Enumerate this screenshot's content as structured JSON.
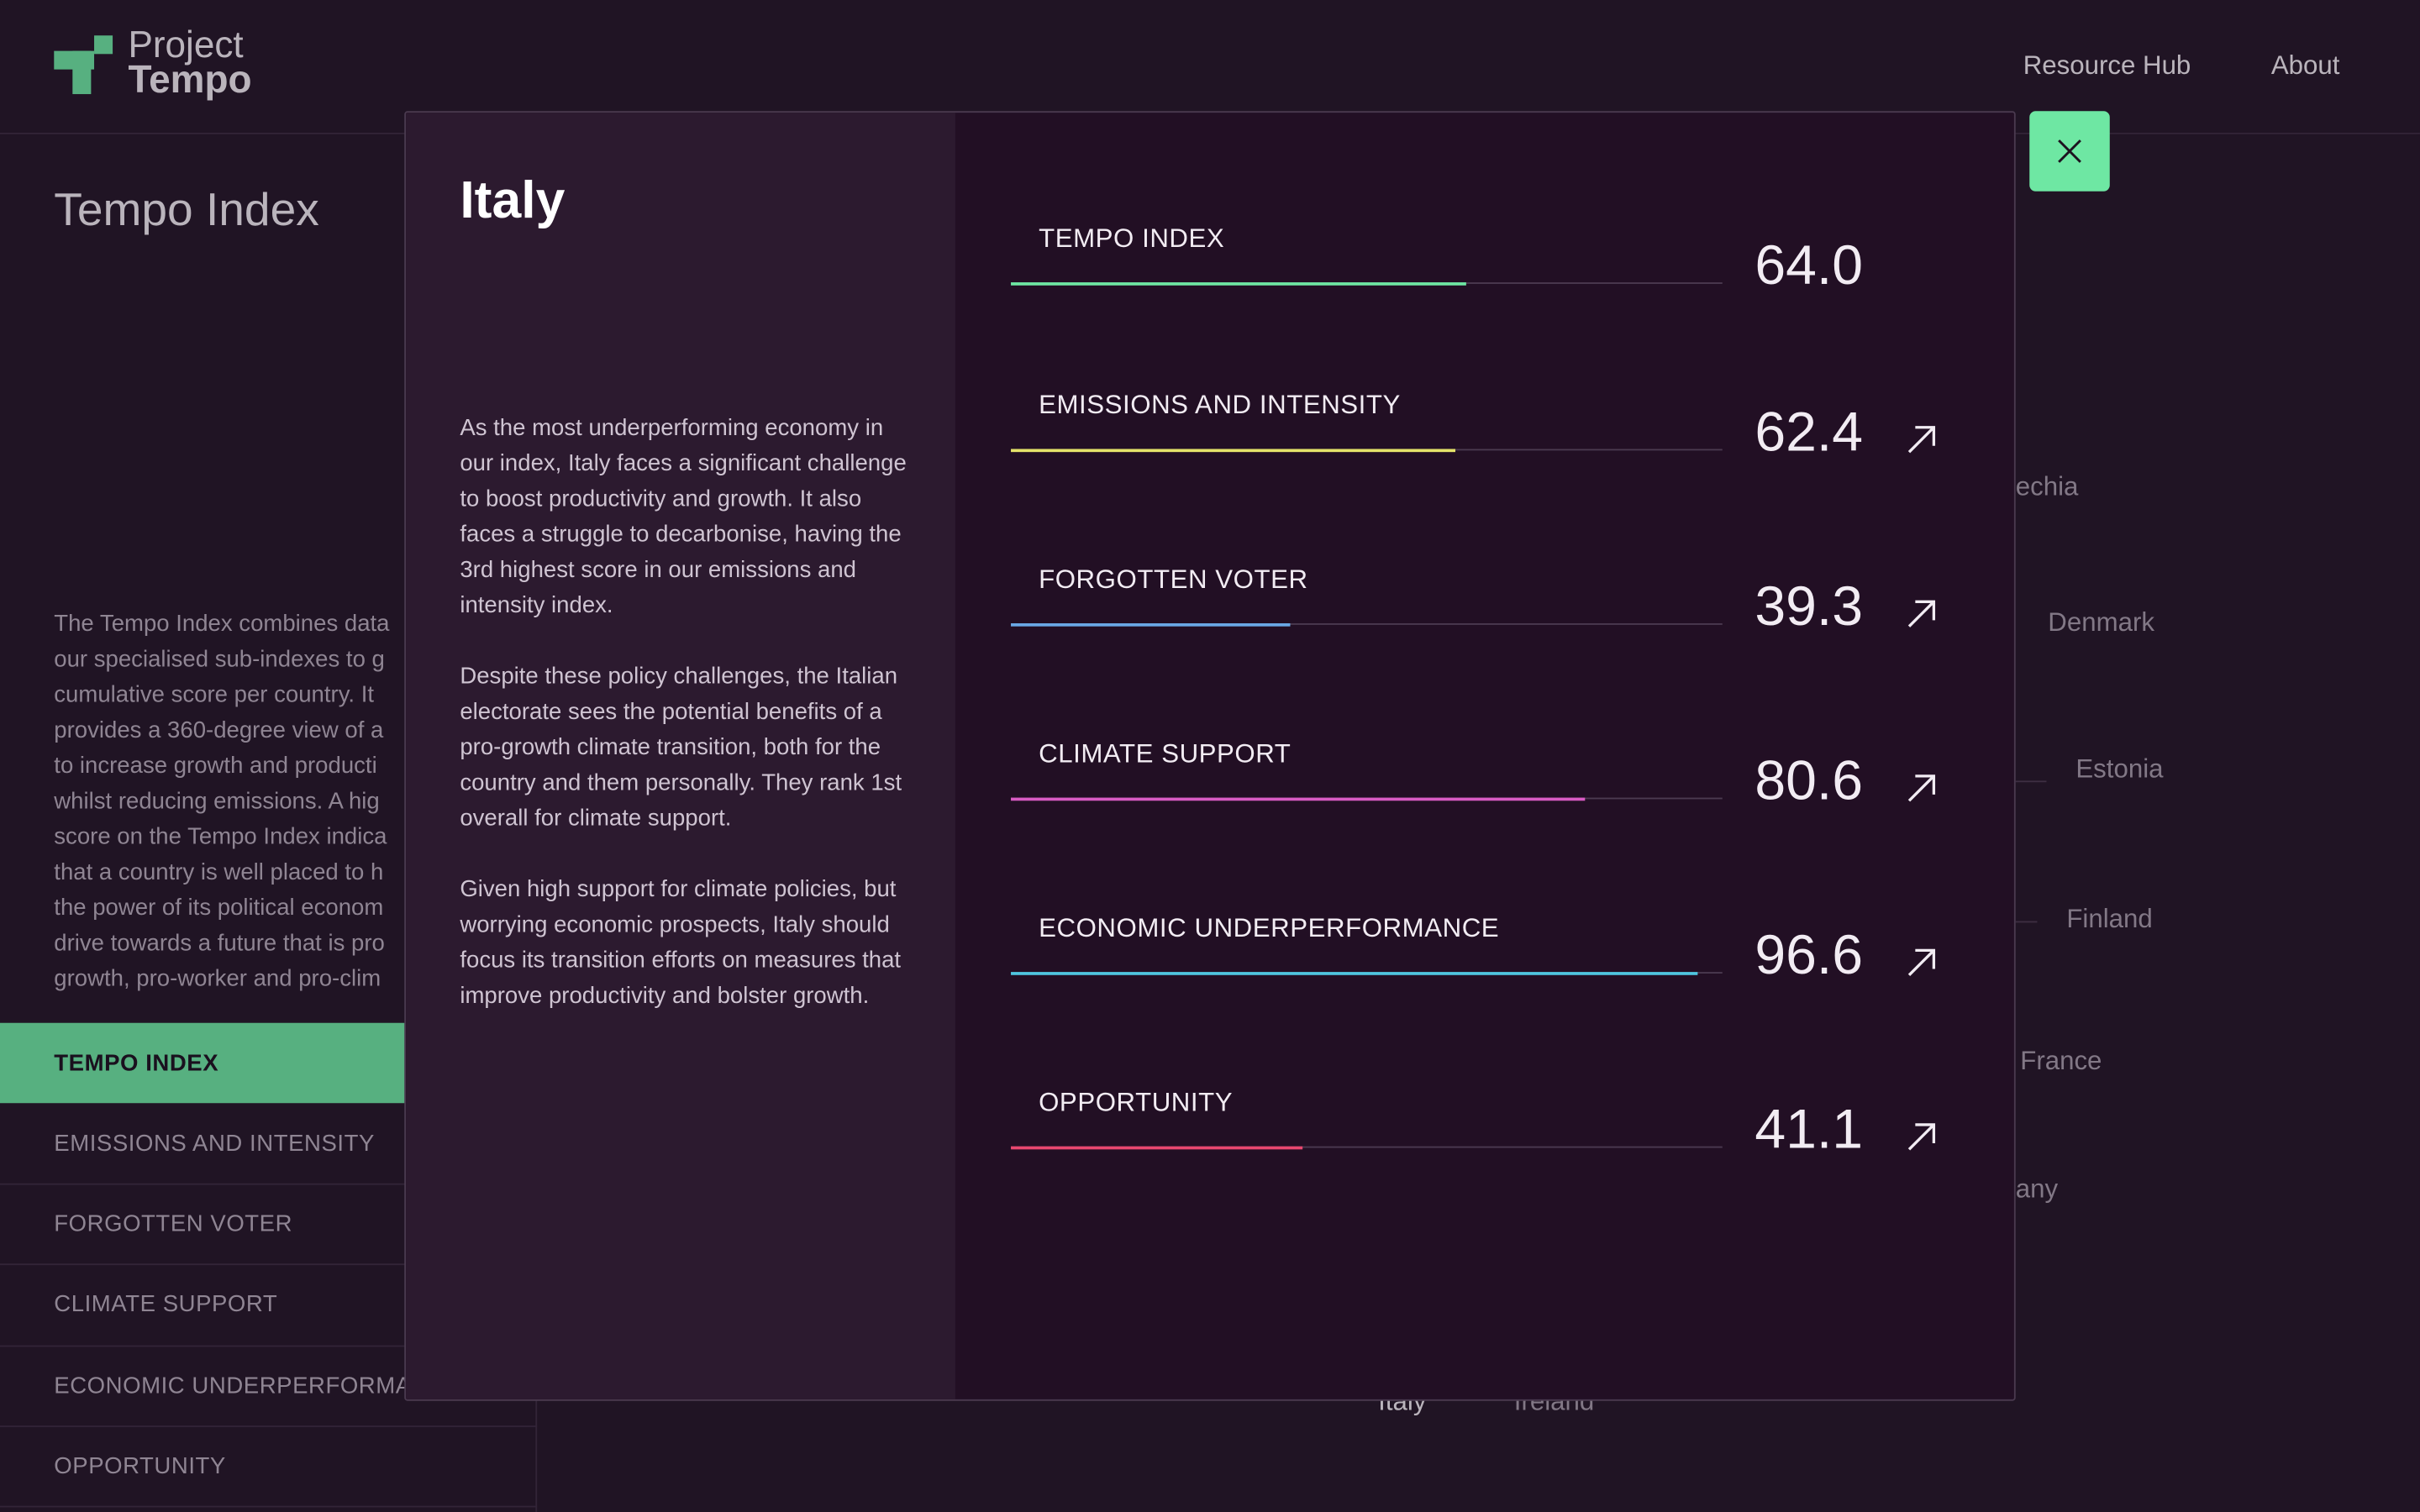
{
  "header": {
    "logo_line1": "Project",
    "logo_line2": "Tempo",
    "nav": [
      "Resource Hub",
      "About"
    ]
  },
  "page": {
    "title": "Tempo Index",
    "description": "The Tempo Index combines data\nour specialised sub-indexes to g\ncumulative score per country. It\nprovides a 360-degree view of a\nto increase growth and producti\nwhilst reducing emissions. A hig\nscore on the Tempo Index indica\nthat a country is well placed to h\nthe power of its political econom\ndrive towards a future that is pro\ngrowth, pro-worker and pro-clim",
    "sidebar": [
      {
        "label": "TEMPO INDEX",
        "active": true
      },
      {
        "label": "EMISSIONS AND INTENSITY",
        "active": false
      },
      {
        "label": "FORGOTTEN VOTER",
        "active": false
      },
      {
        "label": "CLIMATE SUPPORT",
        "active": false
      },
      {
        "label": "ECONOMIC UNDERPERFORMA",
        "active": false
      },
      {
        "label": "OPPORTUNITY",
        "active": false
      }
    ],
    "countries_visible": [
      "echia",
      "Denmark",
      "Estonia",
      "Finland",
      "France",
      "any",
      "Italy",
      "Ireland"
    ]
  },
  "modal": {
    "country": "Italy",
    "paragraphs": [
      "As the most underperforming economy in our index, Italy faces a significant challenge to boost productivity and growth. It also faces a struggle to decarbonise, having the 3rd highest score in our emissions and intensity index.",
      "Despite these policy challenges, the Italian electorate sees the potential benefits of a pro-growth climate transition, both for the country and them personally. They rank 1st overall for climate support.",
      "Given high support for climate policies, but worrying economic prospects, Italy should focus its transition efforts on measures that improve productivity and bolster growth."
    ],
    "metrics": [
      {
        "label": "TEMPO INDEX",
        "value": "64.0",
        "score": 64.0,
        "color": "#6ee7a3",
        "has_arrow": false
      },
      {
        "label": "EMISSIONS AND INTENSITY",
        "value": "62.4",
        "score": 62.4,
        "color": "#e5e36a",
        "has_arrow": true
      },
      {
        "label": "FORGOTTEN VOTER",
        "value": "39.3",
        "score": 39.3,
        "color": "#6aa8e6",
        "has_arrow": true
      },
      {
        "label": "CLIMATE SUPPORT",
        "value": "80.6",
        "score": 80.6,
        "color": "#d95bc4",
        "has_arrow": true
      },
      {
        "label": "ECONOMIC UNDERPERFORMANCE",
        "value": "96.6",
        "score": 96.6,
        "color": "#4fc6e0",
        "has_arrow": true
      },
      {
        "label": "OPPORTUNITY",
        "value": "41.1",
        "score": 41.1,
        "color": "#e8476f",
        "has_arrow": true
      }
    ],
    "close_icon": "close-icon"
  }
}
